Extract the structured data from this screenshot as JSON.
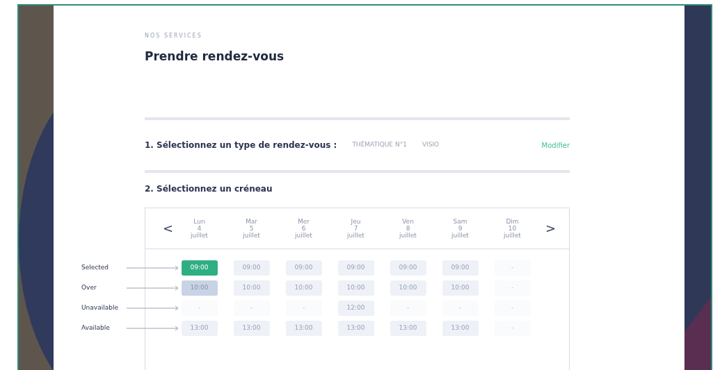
{
  "eyebrow": "NOS SERVICES",
  "title": "Prendre rendez-vous",
  "step1": {
    "label": "1. Sélectionnez un type de rendez-vous :",
    "values": [
      "THÉMATIQUE N°1",
      "VISIO"
    ],
    "action": "Modifier"
  },
  "step2": {
    "label": "2. Sélectionnez un créneau"
  },
  "calendar": {
    "prev": "<",
    "next": ">",
    "days": [
      {
        "name": "Lun",
        "number": "4",
        "month": "juillet"
      },
      {
        "name": "Mar",
        "number": "5",
        "month": "juillet"
      },
      {
        "name": "Mer",
        "number": "6",
        "month": "juillet"
      },
      {
        "name": "Jeu",
        "number": "7",
        "month": "juillet"
      },
      {
        "name": "Ven",
        "number": "8",
        "month": "juillet"
      },
      {
        "name": "Sam",
        "number": "9",
        "month": "juillet"
      },
      {
        "name": "Dim",
        "number": "10",
        "month": "juillet"
      }
    ],
    "rows": [
      {
        "annotation": "Selected",
        "slots": [
          {
            "time": "09:00",
            "kind": "selected"
          },
          {
            "time": "09:00",
            "kind": "available"
          },
          {
            "time": "09:00",
            "kind": "available"
          },
          {
            "time": "09:00",
            "kind": "available"
          },
          {
            "time": "09:00",
            "kind": "available"
          },
          {
            "time": "09:00",
            "kind": "available"
          },
          {
            "time": "-",
            "kind": "unavailable"
          }
        ]
      },
      {
        "annotation": "Over",
        "slots": [
          {
            "time": "10:00",
            "kind": "over"
          },
          {
            "time": "10:00",
            "kind": "available"
          },
          {
            "time": "10:00",
            "kind": "available"
          },
          {
            "time": "10:00",
            "kind": "available"
          },
          {
            "time": "10:00",
            "kind": "available"
          },
          {
            "time": "10:00",
            "kind": "available"
          },
          {
            "time": "-",
            "kind": "unavailable"
          }
        ]
      },
      {
        "annotation": "Unavailable",
        "slots": [
          {
            "time": "-",
            "kind": "unavailable"
          },
          {
            "time": "-",
            "kind": "unavailable"
          },
          {
            "time": "-",
            "kind": "unavailable"
          },
          {
            "time": "12:00",
            "kind": "available"
          },
          {
            "time": "-",
            "kind": "unavailable"
          },
          {
            "time": "-",
            "kind": "unavailable"
          },
          {
            "time": "-",
            "kind": "unavailable"
          }
        ]
      },
      {
        "annotation": "Available",
        "slots": [
          {
            "time": "13:00",
            "kind": "available"
          },
          {
            "time": "13:00",
            "kind": "available"
          },
          {
            "time": "13:00",
            "kind": "available"
          },
          {
            "time": "13:00",
            "kind": "available"
          },
          {
            "time": "13:00",
            "kind": "available"
          },
          {
            "time": "13:00",
            "kind": "available"
          },
          {
            "time": "-",
            "kind": "unavailable"
          }
        ]
      }
    ]
  }
}
